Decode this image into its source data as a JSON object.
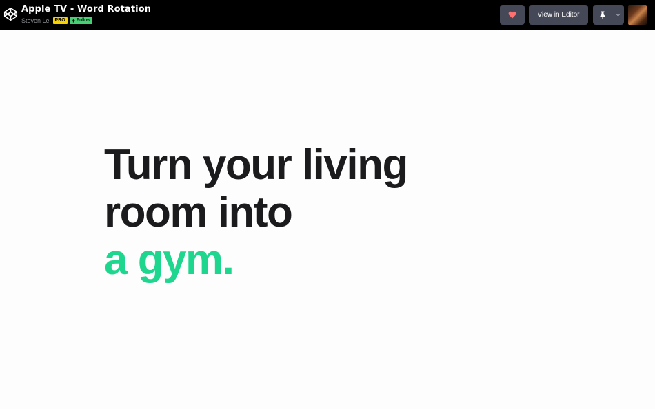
{
  "header": {
    "title": "Apple TV - Word Rotation",
    "author": "Steven Lei",
    "pro_badge": "PRO",
    "follow_label": "Follow",
    "heart_icon": "heart-icon",
    "view_in_editor_label": "View in Editor",
    "pin_icon": "pin-icon",
    "dropdown_icon": "chevron-down-icon",
    "colors": {
      "bar": "#000000",
      "button": "#444857",
      "heart": "#ff6f6f",
      "pro": "#f7d000",
      "follow": "#47cf73"
    }
  },
  "content": {
    "line1": "Turn your living",
    "line2": "room into",
    "line3": "a gym.",
    "colors": {
      "text": "#1b1b1d",
      "accent": "#1fd68f",
      "background": "#fdfdfd"
    }
  }
}
